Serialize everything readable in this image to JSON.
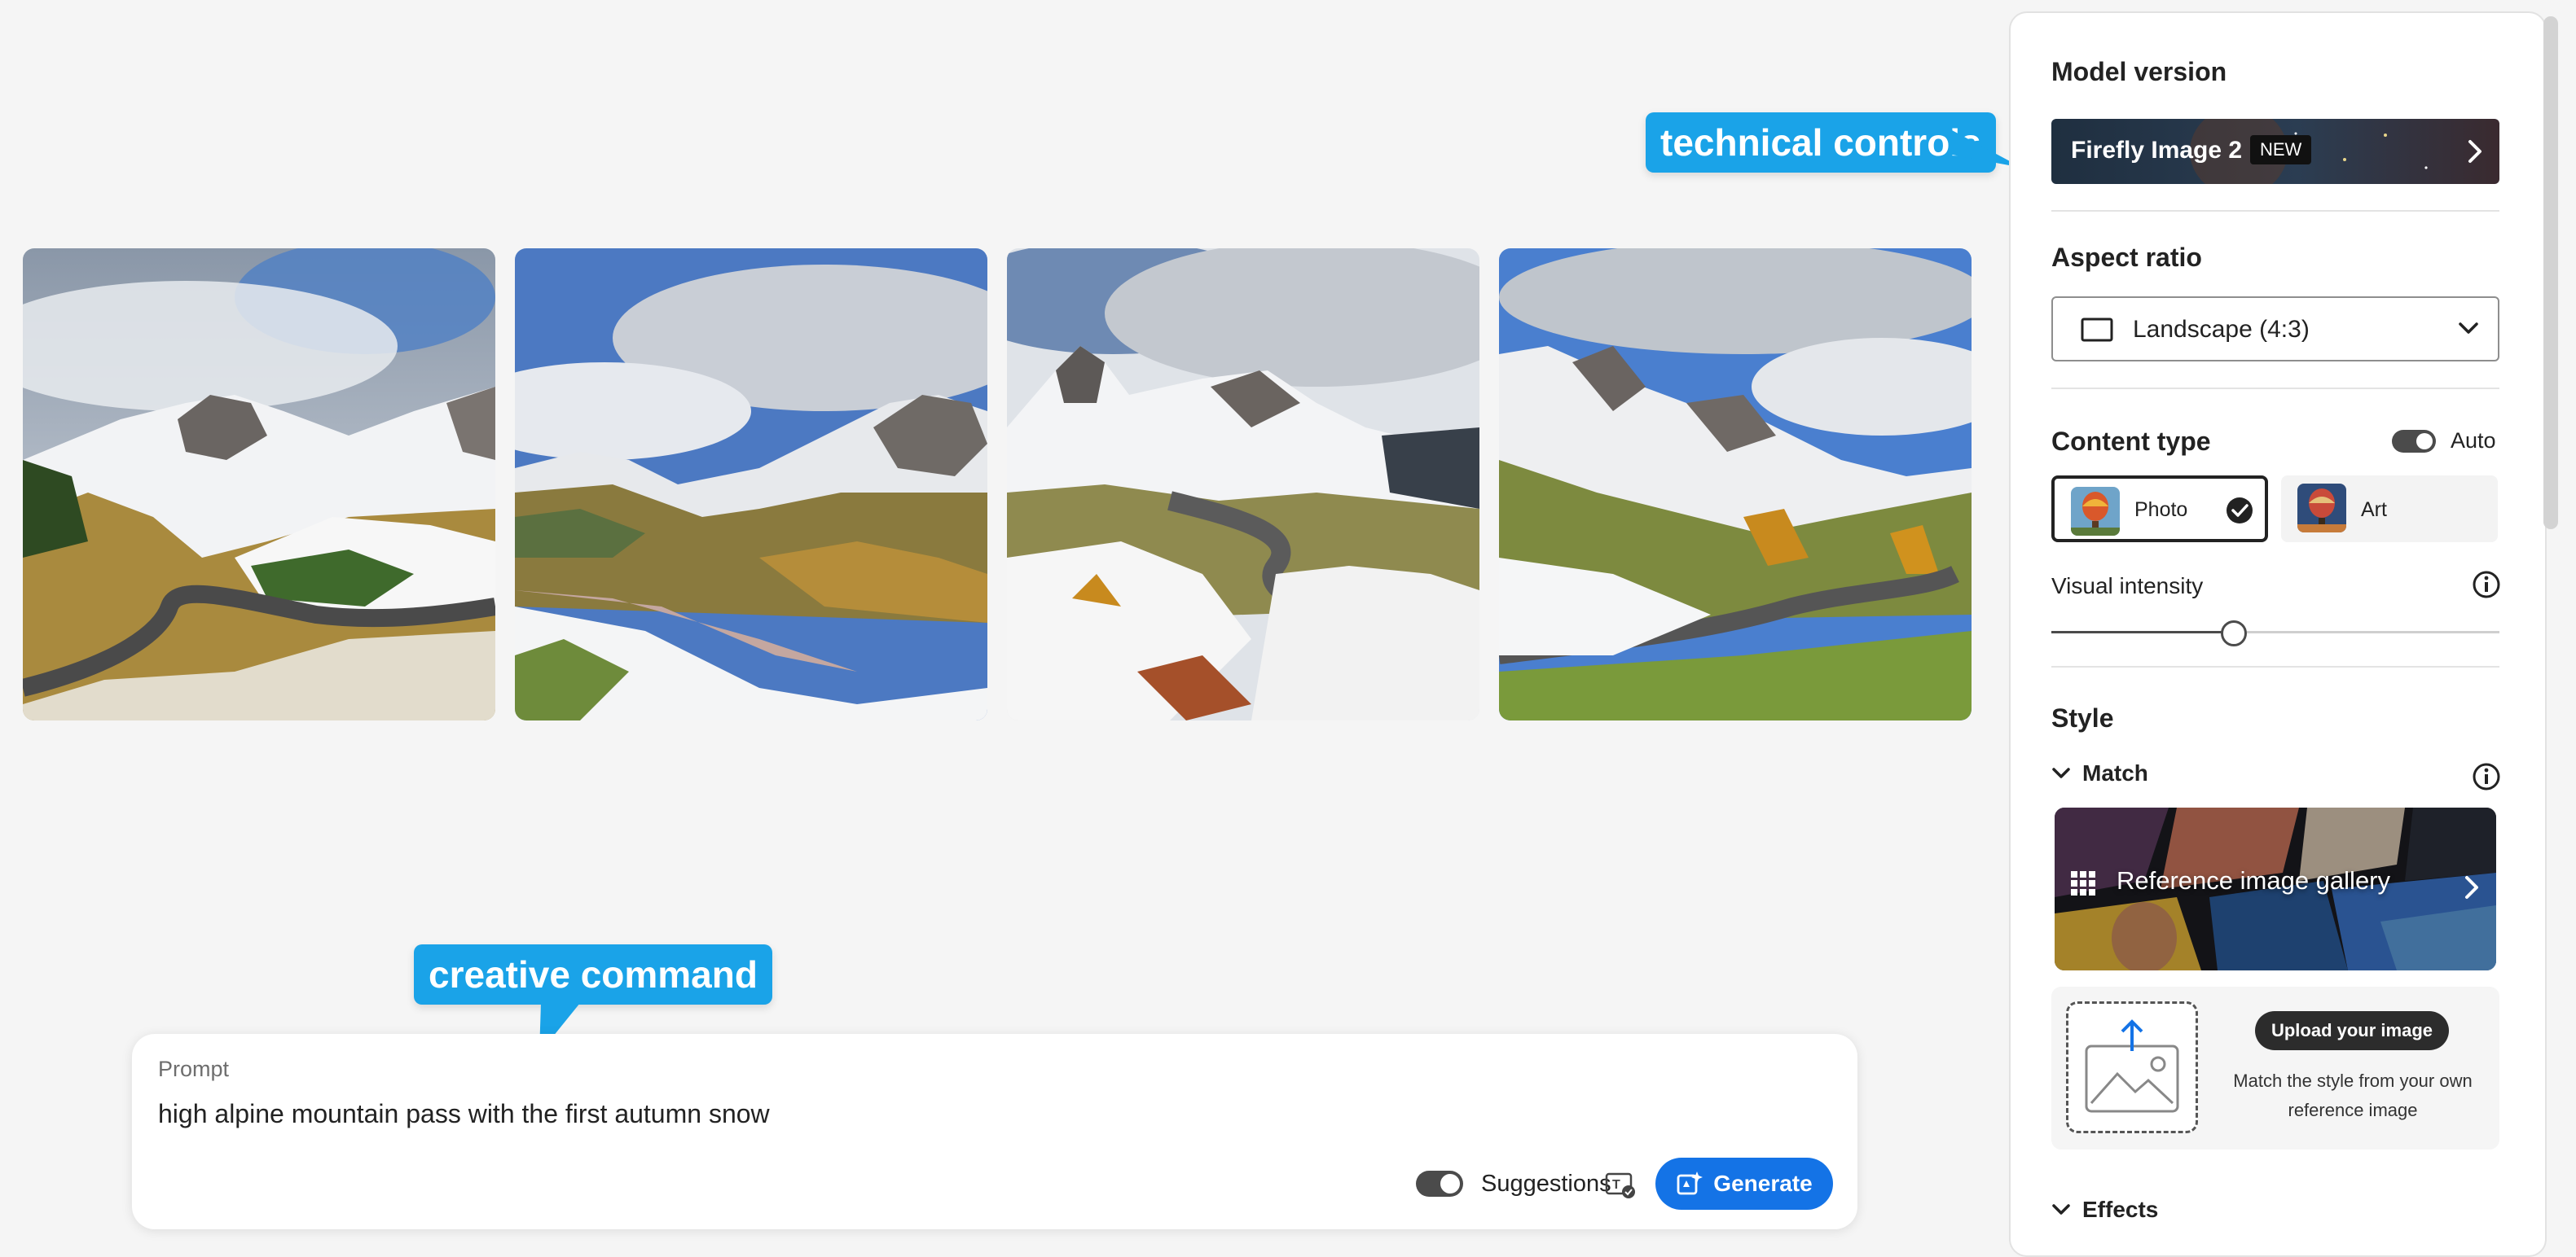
{
  "images": [
    {
      "alt": "Alpine pass with winding road and snowy meadows"
    },
    {
      "alt": "Wide alpine valley with snow patches"
    },
    {
      "alt": "Mountain road curving under rocky peak"
    },
    {
      "alt": "Serpentine road below snowy summit"
    }
  ],
  "callouts": {
    "technical": "technical controls",
    "creative": "creative command"
  },
  "prompt": {
    "label": "Prompt",
    "text": "high alpine mountain pass with the first autumn snow",
    "suggestions_label": "Suggestions",
    "suggestions_on": true,
    "generate_label": "Generate"
  },
  "panel": {
    "model_version_heading": "Model version",
    "model_name": "Firefly Image 2",
    "model_badge": "NEW",
    "aspect_heading": "Aspect ratio",
    "aspect_value": "Landscape (4:3)",
    "content_type_heading": "Content type",
    "auto_label": "Auto",
    "auto_on": true,
    "content_types": [
      {
        "label": "Photo",
        "selected": true
      },
      {
        "label": "Art",
        "selected": false
      }
    ],
    "visual_intensity_label": "Visual intensity",
    "visual_intensity_level": 0.5,
    "style_heading": "Style",
    "match_label": "Match",
    "gallery_label": "Reference image gallery",
    "upload_button": "Upload your image",
    "upload_desc": "Match the style from your own reference image",
    "effects_label": "Effects"
  },
  "colors": {
    "accent_blue": "#1473e6",
    "callout_blue": "#1aa3e8",
    "background": "#f5f5f5"
  },
  "icons": [
    "chevron-right-icon",
    "chevron-down-icon",
    "landscape-ratio-icon",
    "check-icon",
    "info-icon",
    "grid-icon",
    "upload-image-icon",
    "generate-icon",
    "suggestions-icon"
  ]
}
